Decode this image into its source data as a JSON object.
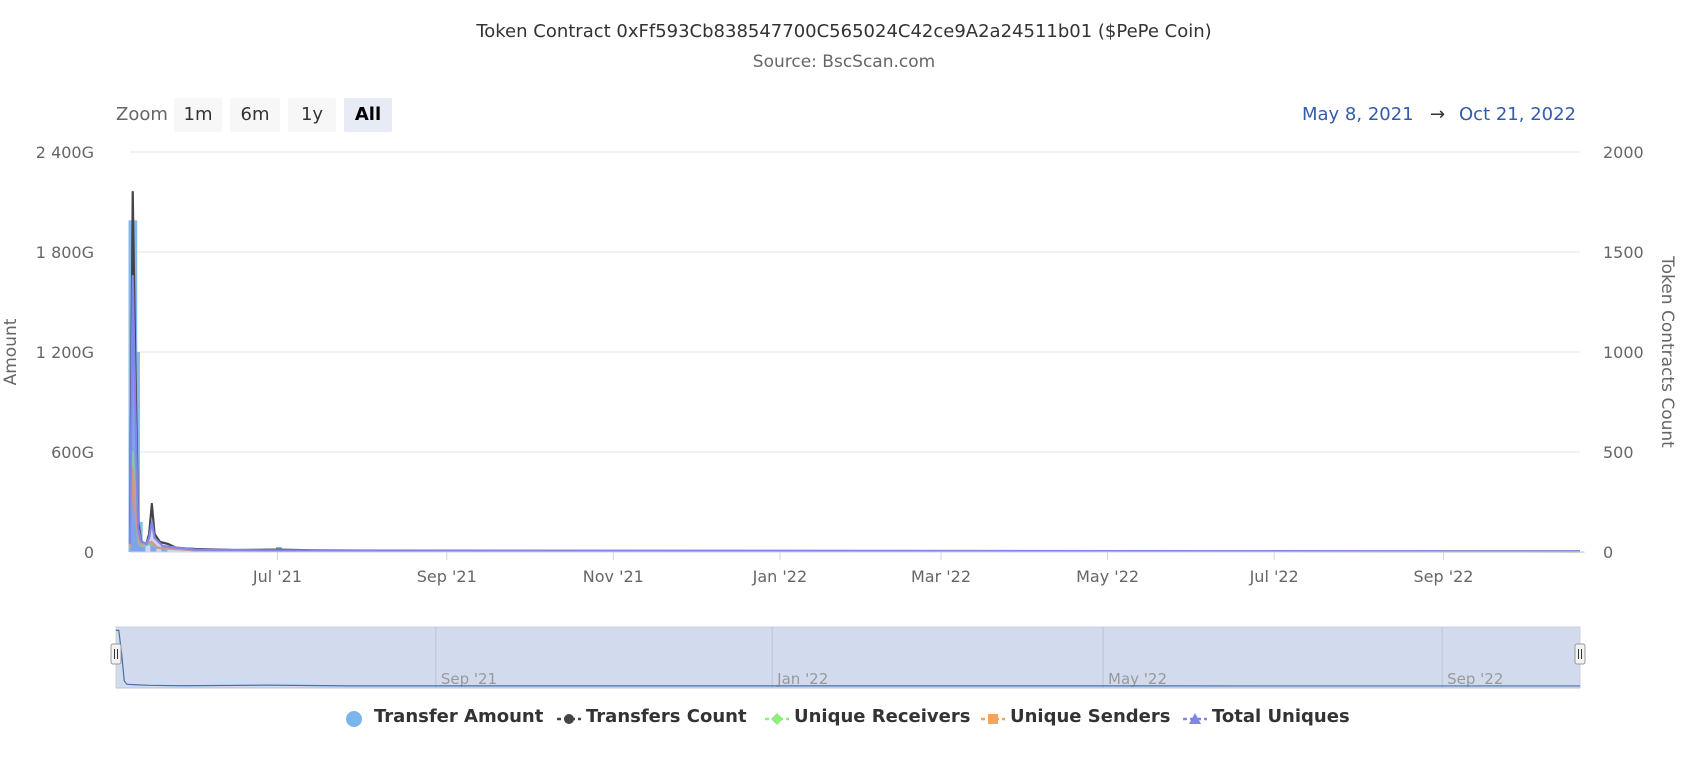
{
  "chart_data": {
    "type": "area",
    "title": "Token Contract 0xFf593Cb838547700C565024C42ce9A2a24511b01 ($PePe Coin)",
    "subtitle": "Source: BscScan.com",
    "zoom": {
      "label": "Zoom",
      "buttons": [
        {
          "label": "1m",
          "active": false
        },
        {
          "label": "6m",
          "active": false
        },
        {
          "label": "1y",
          "active": false
        },
        {
          "label": "All",
          "active": true
        }
      ]
    },
    "range": {
      "from": "May 8, 2021",
      "arrow": "→",
      "to": "Oct 21, 2022"
    },
    "x_axis": {
      "range": [
        "2021-05-08",
        "2022-10-21"
      ],
      "ticks": [
        {
          "date": "2021-07-01",
          "label": "Jul '21"
        },
        {
          "date": "2021-09-01",
          "label": "Sep '21"
        },
        {
          "date": "2021-11-01",
          "label": "Nov '21"
        },
        {
          "date": "2022-01-01",
          "label": "Jan '22"
        },
        {
          "date": "2022-03-01",
          "label": "Mar '22"
        },
        {
          "date": "2022-05-01",
          "label": "May '22"
        },
        {
          "date": "2022-07-01",
          "label": "Jul '22"
        },
        {
          "date": "2022-09-01",
          "label": "Sep '22"
        }
      ]
    },
    "y_axis_left": {
      "title": "Amount",
      "range": [
        0,
        2400
      ],
      "ticks": [
        {
          "value": 0,
          "label": "0"
        },
        {
          "value": 600,
          "label": "600G"
        },
        {
          "value": 1200,
          "label": "1 200G"
        },
        {
          "value": 1800,
          "label": "1 800G"
        },
        {
          "value": 2400,
          "label": "2 400G"
        }
      ]
    },
    "y_axis_right": {
      "title": "Token Contracts Count",
      "range": [
        0,
        2000
      ],
      "ticks": [
        {
          "value": 0,
          "label": "0"
        },
        {
          "value": 500,
          "label": "500"
        },
        {
          "value": 1000,
          "label": "1000"
        },
        {
          "value": 1500,
          "label": "1500"
        },
        {
          "value": 2000,
          "label": "2000"
        }
      ]
    },
    "grid": true,
    "legend_position": "bottom-center",
    "series": [
      {
        "name": "Transfer Amount",
        "type": "column",
        "axis": "left",
        "color": "#7cb5ec",
        "points": [
          [
            "2021-05-08",
            1990
          ],
          [
            "2021-05-09",
            1990
          ],
          [
            "2021-05-10",
            1200
          ],
          [
            "2021-05-11",
            180
          ],
          [
            "2021-05-12",
            60
          ],
          [
            "2021-05-16",
            40
          ],
          [
            "2021-05-20",
            25
          ],
          [
            "2021-06-01",
            10
          ],
          [
            "2021-07-01",
            30
          ],
          [
            "2021-08-01",
            5
          ],
          [
            "2022-10-21",
            2
          ]
        ]
      },
      {
        "name": "Transfers Count",
        "type": "line",
        "axis": "right",
        "color": "#434348",
        "points": [
          [
            "2021-05-08",
            50
          ],
          [
            "2021-05-09",
            1800
          ],
          [
            "2021-05-10",
            900
          ],
          [
            "2021-05-11",
            150
          ],
          [
            "2021-05-12",
            60
          ],
          [
            "2021-05-13",
            35
          ],
          [
            "2021-05-14",
            40
          ],
          [
            "2021-05-15",
            90
          ],
          [
            "2021-05-16",
            240
          ],
          [
            "2021-05-17",
            90
          ],
          [
            "2021-05-19",
            50
          ],
          [
            "2021-05-22",
            40
          ],
          [
            "2021-05-25",
            20
          ],
          [
            "2021-06-01",
            15
          ],
          [
            "2021-06-15",
            10
          ],
          [
            "2021-07-01",
            12
          ],
          [
            "2021-07-15",
            8
          ],
          [
            "2021-09-01",
            5
          ],
          [
            "2022-01-01",
            4
          ],
          [
            "2022-10-21",
            3
          ]
        ]
      },
      {
        "name": "Unique Receivers",
        "type": "line",
        "axis": "right",
        "color": "#90ed7d",
        "points": [
          [
            "2021-05-08",
            20
          ],
          [
            "2021-05-09",
            500
          ],
          [
            "2021-05-10",
            220
          ],
          [
            "2021-05-11",
            60
          ],
          [
            "2021-05-12",
            30
          ],
          [
            "2021-05-16",
            40
          ],
          [
            "2021-05-18",
            20
          ],
          [
            "2021-06-01",
            8
          ],
          [
            "2021-07-01",
            6
          ],
          [
            "2022-10-21",
            2
          ]
        ]
      },
      {
        "name": "Unique Senders",
        "type": "line",
        "axis": "right",
        "color": "#f7a35c",
        "points": [
          [
            "2021-05-08",
            20
          ],
          [
            "2021-05-09",
            420
          ],
          [
            "2021-05-10",
            200
          ],
          [
            "2021-05-11",
            70
          ],
          [
            "2021-05-12",
            40
          ],
          [
            "2021-05-16",
            50
          ],
          [
            "2021-05-18",
            22
          ],
          [
            "2021-06-01",
            8
          ],
          [
            "2021-07-01",
            6
          ],
          [
            "2022-10-21",
            2
          ]
        ]
      },
      {
        "name": "Total Uniques",
        "type": "line",
        "axis": "right",
        "color": "#8085e9",
        "points": [
          [
            "2021-05-08",
            40
          ],
          [
            "2021-05-09",
            1380
          ],
          [
            "2021-05-10",
            700
          ],
          [
            "2021-05-11",
            120
          ],
          [
            "2021-05-12",
            55
          ],
          [
            "2021-05-14",
            40
          ],
          [
            "2021-05-15",
            70
          ],
          [
            "2021-05-16",
            150
          ],
          [
            "2021-05-17",
            70
          ],
          [
            "2021-05-20",
            30
          ],
          [
            "2021-06-01",
            12
          ],
          [
            "2021-07-01",
            8
          ],
          [
            "2022-10-21",
            3
          ]
        ]
      }
    ],
    "navigator": {
      "ticks": [
        {
          "date": "2021-09-01",
          "label": "Sep '21"
        },
        {
          "date": "2022-01-01",
          "label": "Jan '22"
        },
        {
          "date": "2022-05-01",
          "label": "May '22"
        },
        {
          "date": "2022-09-01",
          "label": "Sep '22"
        }
      ],
      "handle_left_icon": "grip-handle-icon",
      "handle_right_icon": "grip-handle-icon"
    },
    "legend": [
      {
        "label": "Transfer Amount",
        "symbol": "circle",
        "color": "#7cb5ec"
      },
      {
        "label": "Transfers Count",
        "symbol": "line-circle",
        "color": "#434348"
      },
      {
        "label": "Unique Receivers",
        "symbol": "line-diamond",
        "color": "#90ed7d"
      },
      {
        "label": "Unique Senders",
        "symbol": "line-square",
        "color": "#f7a35c"
      },
      {
        "label": "Total Uniques",
        "symbol": "line-triangle",
        "color": "#8085e9"
      }
    ]
  }
}
